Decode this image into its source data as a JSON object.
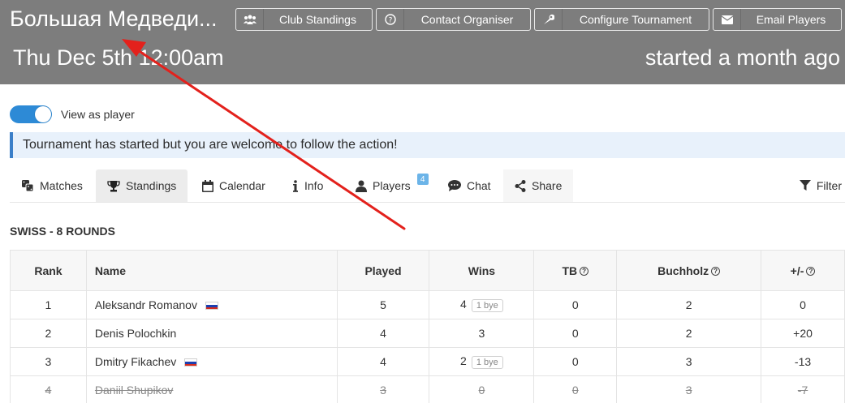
{
  "header": {
    "title": "Большая Медведи...",
    "date": "Thu Dec 5th 12:00am",
    "started": "started a month ago",
    "buttons": [
      {
        "label": "Club Standings",
        "icon": "users-icon"
      },
      {
        "label": "Contact Organiser",
        "icon": "question-circle-icon"
      },
      {
        "label": "Configure Tournament",
        "icon": "wrench-icon"
      },
      {
        "label": "Email Players",
        "icon": "envelope-icon"
      }
    ]
  },
  "toggle": {
    "label": "View as player",
    "on": true
  },
  "notice": "Tournament has started but you are welcome to follow the action!",
  "tabs": [
    {
      "label": "Matches",
      "icon": "dice-icon"
    },
    {
      "label": "Standings",
      "icon": "trophy-icon",
      "active": true
    },
    {
      "label": "Calendar",
      "icon": "calendar-icon"
    },
    {
      "label": "Info",
      "icon": "info-icon"
    },
    {
      "label": "Players",
      "icon": "user-icon",
      "badge": "4"
    },
    {
      "label": "Chat",
      "icon": "comment-icon"
    },
    {
      "label": "Share",
      "icon": "share-icon"
    }
  ],
  "filter": {
    "label": "Filter",
    "icon": "filter-icon"
  },
  "section_title": "SWISS - 8 ROUNDS",
  "table": {
    "columns": [
      "Rank",
      "Name",
      "Played",
      "Wins",
      "TB",
      "Buchholz",
      "+/-"
    ],
    "help_icon_text": "?",
    "rows": [
      {
        "rank": "1",
        "name": "Aleksandr Romanov",
        "flag": "russia-flag",
        "played": "5",
        "wins": "4",
        "bye": "1 bye",
        "tb": "0",
        "buchholz": "2",
        "diff": "0",
        "struck": false
      },
      {
        "rank": "2",
        "name": "Denis Polochkin",
        "flag": "",
        "played": "4",
        "wins": "3",
        "bye": "",
        "tb": "0",
        "buchholz": "2",
        "diff": "+20",
        "struck": false
      },
      {
        "rank": "3",
        "name": "Dmitry Fikachev",
        "flag": "russia-flag",
        "played": "4",
        "wins": "2",
        "bye": "1 bye",
        "tb": "0",
        "buchholz": "3",
        "diff": "-13",
        "struck": false
      },
      {
        "rank": "4",
        "name": "Daniil Shupikov",
        "flag": "",
        "played": "3",
        "wins": "0",
        "bye": "",
        "tb": "0",
        "buchholz": "3",
        "diff": "-7",
        "struck": true
      }
    ]
  },
  "colors": {
    "header_bg": "#7d7d7d",
    "accent": "#2d8ad6",
    "notice_bg": "#e8f1fb",
    "arrow": "#e3211c"
  }
}
